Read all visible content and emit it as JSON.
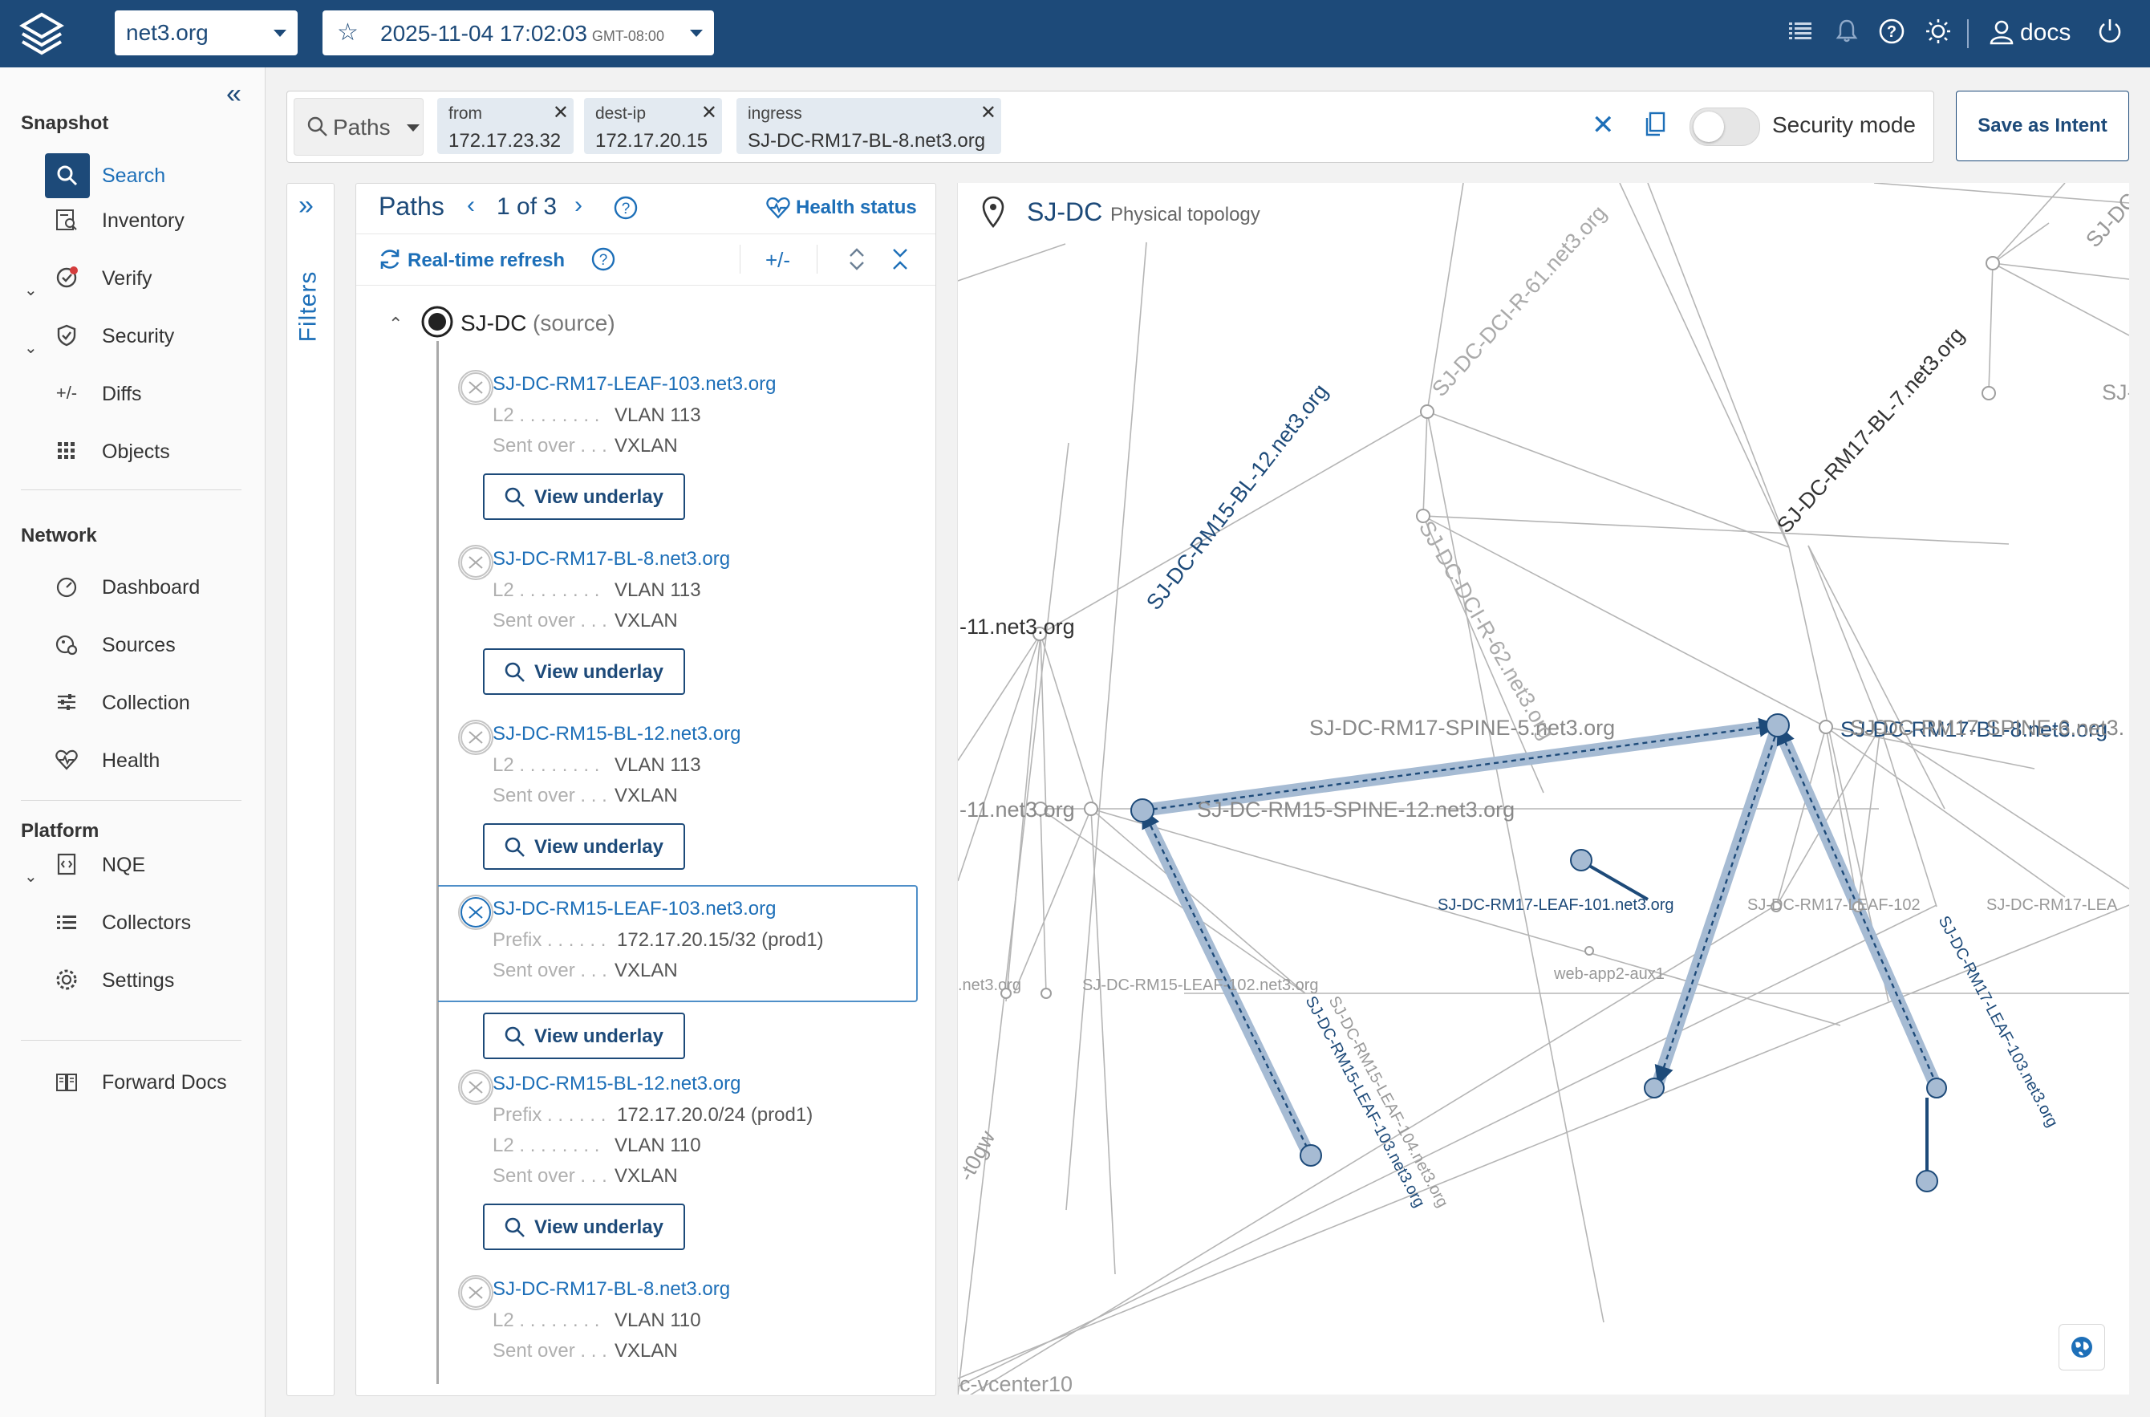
{
  "top": {
    "network": "net3.org",
    "date": "2025-11-04  17:02:03",
    "tz": "GMT-08:00",
    "user": "docs",
    "icons": [
      "list-icon",
      "bell-icon",
      "help-icon",
      "sun-icon",
      "user-icon",
      "power-icon"
    ]
  },
  "sidebar": {
    "snapshot_title": "Snapshot",
    "search": "Search",
    "inventory": "Inventory",
    "verify": "Verify",
    "security": "Security",
    "diffs": "Diffs",
    "objects": "Objects",
    "network_title": "Network",
    "dashboard": "Dashboard",
    "sources": "Sources",
    "collection": "Collection",
    "health": "Health",
    "platform_title": "Platform",
    "nqe": "NQE",
    "collectors": "Collectors",
    "settings": "Settings",
    "docs": "Forward Docs"
  },
  "search": {
    "mode": "Paths",
    "chips": [
      {
        "k": "from",
        "v": "172.17.23.32"
      },
      {
        "k": "dest-ip",
        "v": "172.17.20.15"
      },
      {
        "k": "ingress",
        "v": "SJ-DC-RM17-BL-8.net3.org"
      }
    ],
    "security_mode": "Security mode",
    "save_intent": "Save as Intent"
  },
  "filters_label": "Filters",
  "paths": {
    "title": "Paths",
    "counter": "1 of 3",
    "health": "Health status",
    "refresh": "Real-time refresh",
    "diff_icon": "+/-",
    "source_name": "SJ-DC",
    "source_suffix": "(source)",
    "view_underlay": "View underlay",
    "steps": [
      {
        "name": "SJ-DC-RM17-LEAF-103.net3.org",
        "rows": [
          [
            "L2",
            "VLAN 113"
          ],
          [
            "Sent over",
            "VXLAN"
          ]
        ]
      },
      {
        "name": "SJ-DC-RM17-BL-8.net3.org",
        "rows": [
          [
            "L2",
            "VLAN 113"
          ],
          [
            "Sent over",
            "VXLAN"
          ]
        ]
      },
      {
        "name": "SJ-DC-RM15-BL-12.net3.org",
        "rows": [
          [
            "L2",
            "VLAN 113"
          ],
          [
            "Sent over",
            "VXLAN"
          ]
        ]
      },
      {
        "name": "SJ-DC-RM15-LEAF-103.net3.org",
        "rows": [
          [
            "Prefix",
            "172.17.20.15/32 (prod1)"
          ],
          [
            "Sent over",
            "VXLAN"
          ]
        ]
      },
      {
        "name": "SJ-DC-RM15-BL-12.net3.org",
        "rows": [
          [
            "Prefix",
            "172.17.20.0/24 (prod1)"
          ],
          [
            "L2",
            "VLAN 110"
          ],
          [
            "Sent over",
            "VXLAN"
          ]
        ]
      },
      {
        "name": "SJ-DC-RM17-BL-8.net3.org",
        "rows": [
          [
            "L2",
            "VLAN 110"
          ],
          [
            "Sent over",
            "VXLAN"
          ]
        ]
      }
    ]
  },
  "topology": {
    "site": "SJ-DC",
    "subtitle": "Physical topology",
    "labels": {
      "dci61": "SJ-DC-DCI-R-61.net3.org",
      "dci62": "SJ-DC-DCI-R-62.net3.org",
      "bl7": "SJ-DC-RM17-BL-7.net3.org",
      "bl8": "SJ-DC-RM17-BL-8.net3.org",
      "bl12": "SJ-DC-RM15-BL-12.net3.org",
      "l11a": "-11.net3.org",
      "l11b": "-11.net3.org",
      "spine5": "SJ-DC-RM17-SPINE-5.net3.org",
      "spine6": "SJ-DC-RM17-SPINE-6.net3.",
      "spine12": "SJ-DC-RM15-SPINE-12.net3.org",
      "leaf101": "SJ-DC-RM17-LEAF-101.net3.org",
      "leaf102": "SJ-DC-RM17-LEAF-102",
      "leaf102s": ".net3.org",
      "leafX": "SJ-DC-RM17-LEA",
      "r15leaf102": "SJ-DC-RM15-LEAF-102.net3.org",
      "r15leaf103": "SJ-DC-RM15-LEAF-103.net3.org",
      "r15leaf104": "SJ-DC-RM15-LEAF-104.net3.org",
      "r17leaf103": "SJ-DC-RM17-LEAF-103.net3.org",
      "webapp": "web-app2-aux1",
      "netorg": ".net3.org",
      "t0gw": "-t0gw",
      "vcenter": "c-vcenter10",
      "tr1": "SJ-DC-S",
      "tr2": "SJ-D"
    }
  }
}
